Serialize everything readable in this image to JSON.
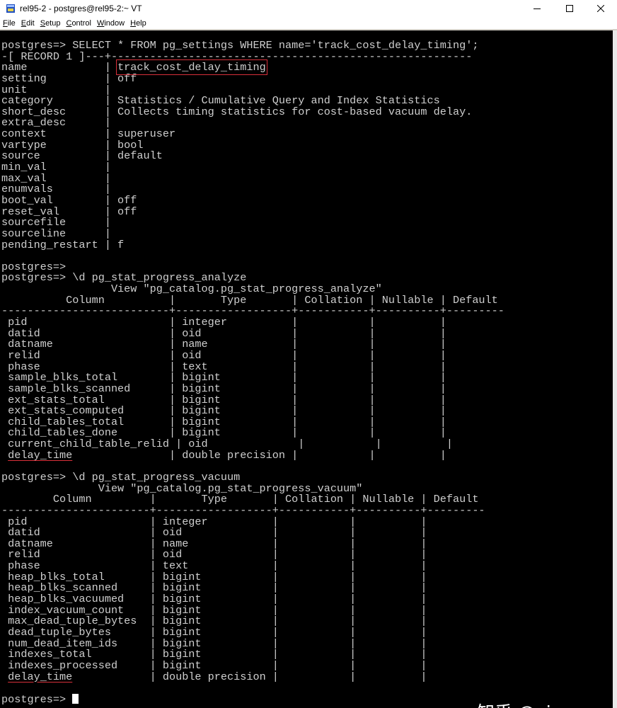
{
  "window": {
    "title": "rel95-2 - postgres@rel95-2:~ VT",
    "icon": "terminal-app-icon",
    "controls": [
      "minimize-icon",
      "maximize-icon",
      "close-icon"
    ]
  },
  "menu": [
    {
      "mnemonic": "F",
      "rest": "ile"
    },
    {
      "mnemonic": "E",
      "rest": "dit"
    },
    {
      "mnemonic": "S",
      "rest": "etup"
    },
    {
      "mnemonic": "C",
      "rest": "ontrol"
    },
    {
      "mnemonic": "W",
      "rest": "indow"
    },
    {
      "mnemonic": "H",
      "rest": "elp"
    }
  ],
  "colors": {
    "terminal_bg": "#000000",
    "terminal_fg": "#cfcfcf",
    "annotation_red": "#d8303a"
  },
  "terminal": {
    "lines": [
      {
        "text": "postgres=> SELECT * FROM pg_settings WHERE name='track_cost_delay_timing';"
      },
      {
        "text": "-[ RECORD 1 ]---+--------------------------------------------------------"
      },
      {
        "pre": "name            | ",
        "mark": "track_cost_delay_timing",
        "mark_style": "box"
      },
      {
        "text": "setting         | off"
      },
      {
        "text": "unit            |"
      },
      {
        "text": "category        | Statistics / Cumulative Query and Index Statistics"
      },
      {
        "text": "short_desc      | Collects timing statistics for cost-based vacuum delay."
      },
      {
        "text": "extra_desc      |"
      },
      {
        "text": "context         | superuser"
      },
      {
        "text": "vartype         | bool"
      },
      {
        "text": "source          | default"
      },
      {
        "text": "min_val         |"
      },
      {
        "text": "max_val         |"
      },
      {
        "text": "enumvals        |"
      },
      {
        "text": "boot_val        | off"
      },
      {
        "text": "reset_val       | off"
      },
      {
        "text": "sourcefile      |"
      },
      {
        "text": "sourceline      |"
      },
      {
        "text": "pending_restart | f"
      },
      {
        "text": ""
      },
      {
        "text": "postgres=>"
      },
      {
        "text": "postgres=> \\d pg_stat_progress_analyze"
      },
      {
        "text": "                 View \"pg_catalog.pg_stat_progress_analyze\""
      },
      {
        "text": "          Column          |       Type       | Collation | Nullable | Default"
      },
      {
        "text": "--------------------------+------------------+-----------+----------+---------"
      },
      {
        "text": " pid                      | integer          |           |          |"
      },
      {
        "text": " datid                    | oid              |           |          |"
      },
      {
        "text": " datname                  | name             |           |          |"
      },
      {
        "text": " relid                    | oid              |           |          |"
      },
      {
        "text": " phase                    | text             |           |          |"
      },
      {
        "text": " sample_blks_total        | bigint           |           |          |"
      },
      {
        "text": " sample_blks_scanned      | bigint           |           |          |"
      },
      {
        "text": " ext_stats_total          | bigint           |           |          |"
      },
      {
        "text": " ext_stats_computed       | bigint           |           |          |"
      },
      {
        "text": " child_tables_total       | bigint           |           |          |"
      },
      {
        "text": " child_tables_done        | bigint           |           |          |"
      },
      {
        "text": " current_child_table_relid | oid              |           |          |"
      },
      {
        "pre": " ",
        "mark": "delay_time",
        "mark_style": "underline",
        "post": "               | double precision |           |          |"
      },
      {
        "text": ""
      },
      {
        "text": "postgres=> \\d pg_stat_progress_vacuum"
      },
      {
        "text": "               View \"pg_catalog.pg_stat_progress_vacuum\""
      },
      {
        "text": "        Column         |       Type       | Collation | Nullable | Default"
      },
      {
        "text": "-----------------------+------------------+-----------+----------+---------"
      },
      {
        "text": " pid                   | integer          |           |          |"
      },
      {
        "text": " datid                 | oid              |           |          |"
      },
      {
        "text": " datname               | name             |           |          |"
      },
      {
        "text": " relid                 | oid              |           |          |"
      },
      {
        "text": " phase                 | text             |           |          |"
      },
      {
        "text": " heap_blks_total       | bigint           |           |          |"
      },
      {
        "text": " heap_blks_scanned     | bigint           |           |          |"
      },
      {
        "text": " heap_blks_vacuumed    | bigint           |           |          |"
      },
      {
        "text": " index_vacuum_count    | bigint           |           |          |"
      },
      {
        "text": " max_dead_tuple_bytes  | bigint           |           |          |"
      },
      {
        "text": " dead_tuple_bytes      | bigint           |           |          |"
      },
      {
        "text": " num_dead_item_ids     | bigint           |           |          |"
      },
      {
        "text": " indexes_total         | bigint           |           |          |"
      },
      {
        "text": " indexes_processed     | bigint           |           |          |"
      },
      {
        "pre": " ",
        "mark": "delay_time",
        "mark_style": "underline",
        "post": "            | double precision |           |          |"
      },
      {
        "text": ""
      },
      {
        "text": "postgres=> ",
        "cursor": true
      }
    ]
  },
  "watermark": "知乎 @xiongcc"
}
